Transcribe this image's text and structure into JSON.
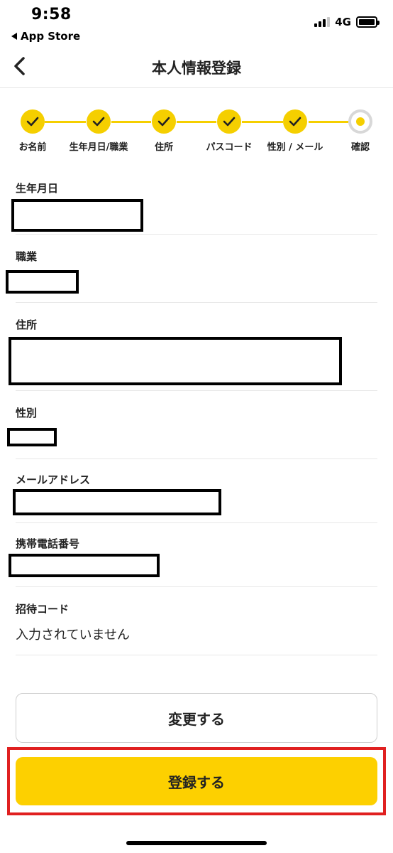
{
  "status_bar": {
    "time": "9:58",
    "back_app": "App Store",
    "network": "4G"
  },
  "nav": {
    "title": "本人情報登録",
    "back_icon": "chevron-left-icon"
  },
  "stepper": {
    "accent_color": "#f5cf00",
    "steps": [
      {
        "label": "お名前",
        "state": "done"
      },
      {
        "label": "生年月日/職業",
        "state": "done"
      },
      {
        "label": "住所",
        "state": "done"
      },
      {
        "label": "パスコード",
        "state": "done"
      },
      {
        "label": "性別 / メール",
        "state": "done"
      },
      {
        "label": "確認",
        "state": "current"
      }
    ]
  },
  "fields": {
    "birthdate": {
      "label": "生年月日"
    },
    "occupation": {
      "label": "職業"
    },
    "address": {
      "label": "住所"
    },
    "gender": {
      "label": "性別"
    },
    "email": {
      "label": "メールアドレス"
    },
    "phone": {
      "label": "携帯電話番号"
    },
    "invite_code": {
      "label": "招待コード",
      "value": "入力されていません"
    }
  },
  "buttons": {
    "change_label": "変更する",
    "register_label": "登録する",
    "register_color": "#fdd000",
    "highlight_color": "#e02020"
  }
}
